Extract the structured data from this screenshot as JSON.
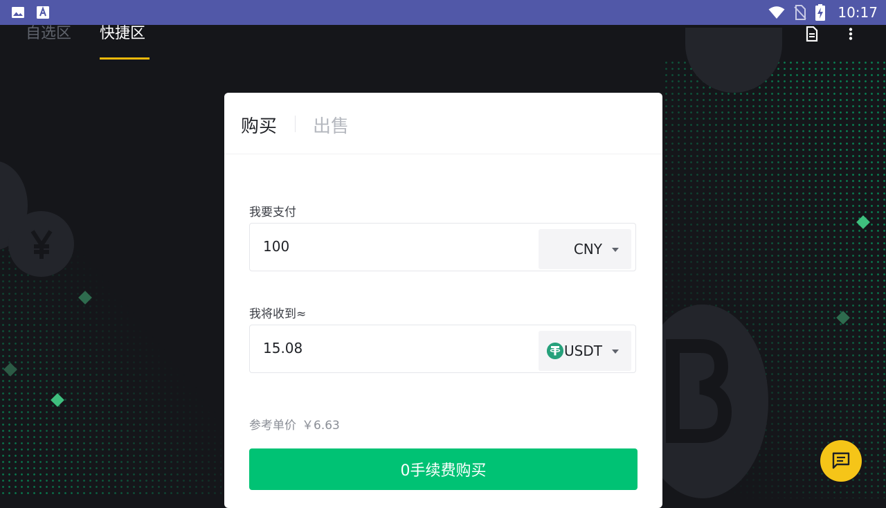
{
  "status_bar": {
    "time": "10:17",
    "left_icons": [
      "image-icon",
      "text-a-icon"
    ],
    "right_icons": [
      "wifi-icon",
      "no-sim-icon",
      "battery-charging-icon"
    ]
  },
  "top_tabs": {
    "favorites": "自选区",
    "quick": "快捷区",
    "active": "快捷区"
  },
  "top_actions": [
    "document-icon",
    "more-vert-icon"
  ],
  "trade_card": {
    "tabs": {
      "buy": "购买",
      "sell": "出售",
      "active": "购买"
    },
    "pay": {
      "label": "我要支付",
      "value": "100",
      "currency": "CNY"
    },
    "receive": {
      "label": "我将收到≈",
      "value": "15.08",
      "currency": "USDT",
      "currency_icon": "tether-icon"
    },
    "reference_price": {
      "label": "参考单价",
      "value": "￥6.63"
    },
    "submit_label": "0手续费购买"
  },
  "chat_button_icon": "chat-icon",
  "colors": {
    "status_bar": "#5158a8",
    "background": "#15161a",
    "accent_underline": "#f0b90b",
    "buy_button": "#00c274",
    "chat_fab": "#f5c518",
    "tether": "#26a17b"
  }
}
